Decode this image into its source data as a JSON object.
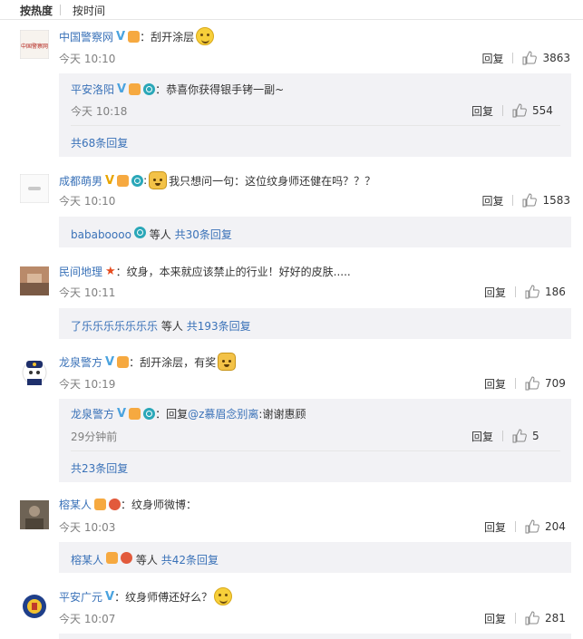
{
  "sort": {
    "hot": "按热度",
    "time": "按时间"
  },
  "common": {
    "reply": "回复"
  },
  "comments": [
    {
      "user": "中国警察网",
      "text": "：刮开涂层",
      "time": "今天 10:10",
      "likes": "3863",
      "avatar_text": "中国警察网",
      "reply": {
        "user": "平安洛阳",
        "text": "：恭喜你获得银手铐一副~",
        "time": "今天 10:18",
        "likes": "554"
      },
      "more": "共68条回复"
    },
    {
      "user": "成都萌男",
      "text": "我只想问一句：这位纹身师还健在吗？？？",
      "time": "今天 10:10",
      "likes": "1583",
      "more_user": "bababoooo",
      "more_suffix": "等人",
      "more": "共30条回复"
    },
    {
      "user": "民间地理",
      "text": "：纹身，本来就应该禁止的行业！好好的皮肤.....",
      "time": "今天 10:11",
      "likes": "186",
      "more_user": "了乐乐乐乐乐乐乐",
      "more_suffix": "等人",
      "more": "共193条回复"
    },
    {
      "user": "龙泉警方",
      "text": "：刮开涂层，有奖",
      "time": "今天 10:19",
      "likes": "709",
      "reply": {
        "user": "龙泉警方",
        "text": "：回复",
        "mention": "@z慕眉念别离",
        "text2": ":谢谢惠顾",
        "time": "29分钟前",
        "likes": "5"
      },
      "more": "共23条回复"
    },
    {
      "user": "榕某人",
      "text": "：纹身师微博：",
      "time": "今天 10:03",
      "likes": "204",
      "more_user": "榕某人",
      "more_suffix": "等人",
      "more": "共42条回复"
    },
    {
      "user": "平安广元",
      "text": "：纹身师傅还好么？",
      "time": "今天 10:07",
      "likes": "281"
    }
  ],
  "colors": {
    "link": "#3a72b8",
    "username": "#eb7350",
    "subbox": "#f2f2f5"
  }
}
